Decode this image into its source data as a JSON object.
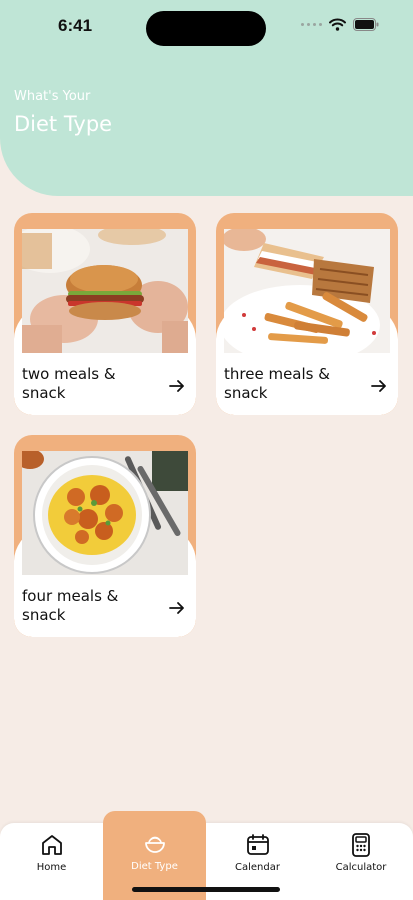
{
  "status_bar": {
    "time": "6:41"
  },
  "header": {
    "subtitle": "What's Your",
    "title": "Diet Type",
    "color": "#bfe5d6"
  },
  "cards": [
    {
      "label": "two meals & snack",
      "image": "burger-photo"
    },
    {
      "label": "three meals & snack",
      "image": "sandwich-fries-photo"
    },
    {
      "label": "four meals & snack",
      "image": "shrimp-rice-photo"
    }
  ],
  "accent_color": "#f0b07e",
  "bottom_nav": {
    "items": [
      {
        "label": "Home",
        "icon": "home-icon",
        "active": false
      },
      {
        "label": "Diet Type",
        "icon": "bowl-icon",
        "active": true
      },
      {
        "label": "Calendar",
        "icon": "calendar-icon",
        "active": false
      },
      {
        "label": "Calculator",
        "icon": "calculator-icon",
        "active": false
      }
    ]
  }
}
